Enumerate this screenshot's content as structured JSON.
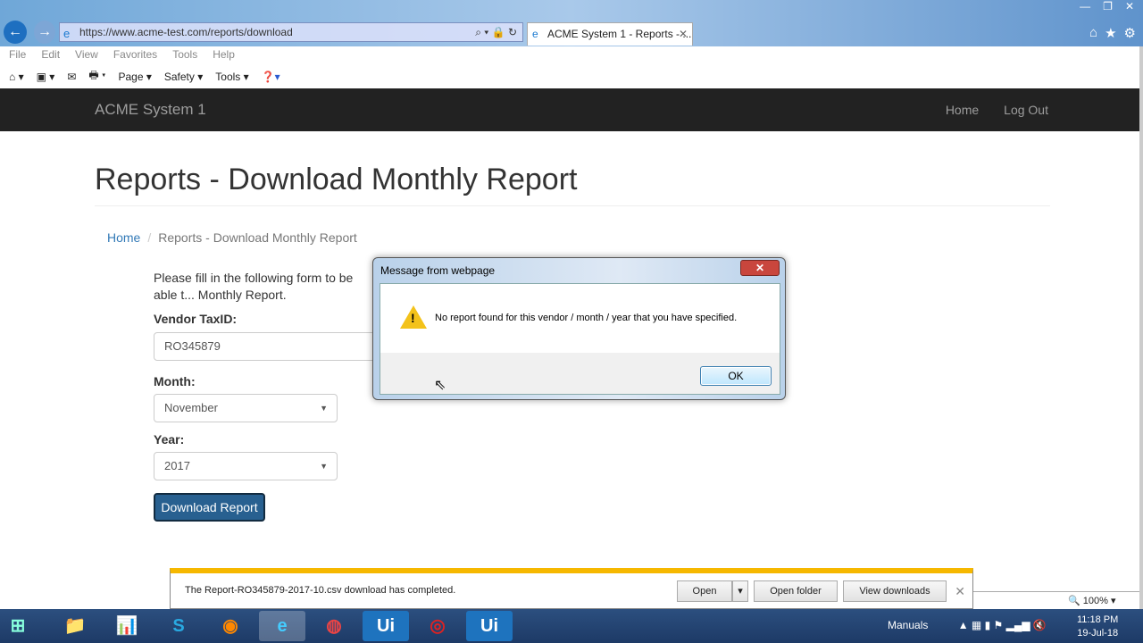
{
  "browser": {
    "url": "https://www.acme-test.com/reports/download",
    "tab_title": "ACME System 1 - Reports - ...",
    "menu": [
      "File",
      "Edit",
      "View",
      "Favorites",
      "Tools",
      "Help"
    ],
    "commands": [
      "Page",
      "Safety",
      "Tools"
    ],
    "zoom": "100%"
  },
  "site": {
    "brand": "ACME System 1",
    "nav": [
      "Home",
      "Log Out"
    ]
  },
  "page": {
    "title": "Reports - Download Monthly Report",
    "breadcrumb": [
      "Home",
      "Reports - Download Monthly Report"
    ],
    "intro": "Please fill in the following form to be able t... Monthly Report.",
    "vendor_label": "Vendor TaxID:",
    "vendor_value": "RO345879",
    "month_label": "Month:",
    "month_value": "November",
    "year_label": "Year:",
    "year_value": "2017",
    "download_button": "Download Report"
  },
  "dialog": {
    "title": "Message from webpage",
    "message": "No report found for this vendor / month / year that you have specified.",
    "ok": "OK",
    "close": "✕"
  },
  "download_bar": {
    "message": "The Report-RO345879-2017-10.csv download has completed.",
    "open": "Open",
    "open_folder": "Open folder",
    "view_downloads": "View downloads"
  },
  "taskbar": {
    "toolbar": "Manuals",
    "time": "11:18 PM",
    "date": "19-Jul-18"
  }
}
